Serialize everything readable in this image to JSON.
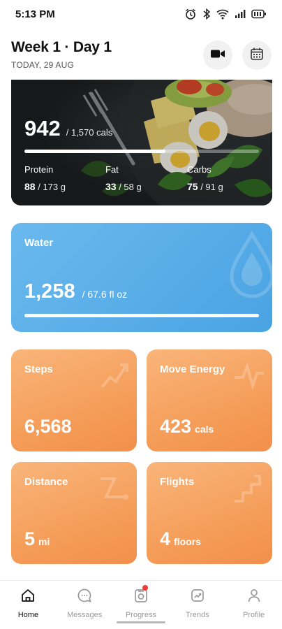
{
  "status_bar": {
    "time": "5:13 PM"
  },
  "header": {
    "title": "Week 1 · Day 1",
    "subtitle": "TODAY, 29 AUG"
  },
  "calories": {
    "value": "942",
    "goal": "/ 1,570 cals",
    "progress": 0.6
  },
  "macros": [
    {
      "label": "Protein",
      "value": "88",
      "goal": "/ 173 g"
    },
    {
      "label": "Fat",
      "value": "33",
      "goal": "/ 58 g"
    },
    {
      "label": "Carbs",
      "value": "75",
      "goal": "/ 91 g"
    }
  ],
  "water": {
    "label": "Water",
    "value": "1,258",
    "goal": "/  67.6 fl oz",
    "progress": 1.0
  },
  "tiles": {
    "steps": {
      "label": "Steps",
      "value": "6,568",
      "unit": ""
    },
    "move": {
      "label": "Move Energy",
      "value": "423",
      "unit": "cals"
    },
    "distance": {
      "label": "Distance",
      "value": "5",
      "unit": "mi"
    },
    "flights": {
      "label": "Flights",
      "value": "4",
      "unit": "floors"
    }
  },
  "nav": [
    {
      "label": "Home",
      "icon": "home-icon",
      "active": true
    },
    {
      "label": "Messages",
      "icon": "messages-icon",
      "active": false
    },
    {
      "label": "Progress",
      "icon": "progress-icon",
      "active": false
    },
    {
      "label": "Trends",
      "icon": "trends-icon",
      "active": false
    },
    {
      "label": "Profile",
      "icon": "profile-icon",
      "active": false
    }
  ],
  "colors": {
    "water_card": "#4aa3e2",
    "activity_tile": "#f49a55",
    "notification_dot": "#ef3b3b"
  }
}
